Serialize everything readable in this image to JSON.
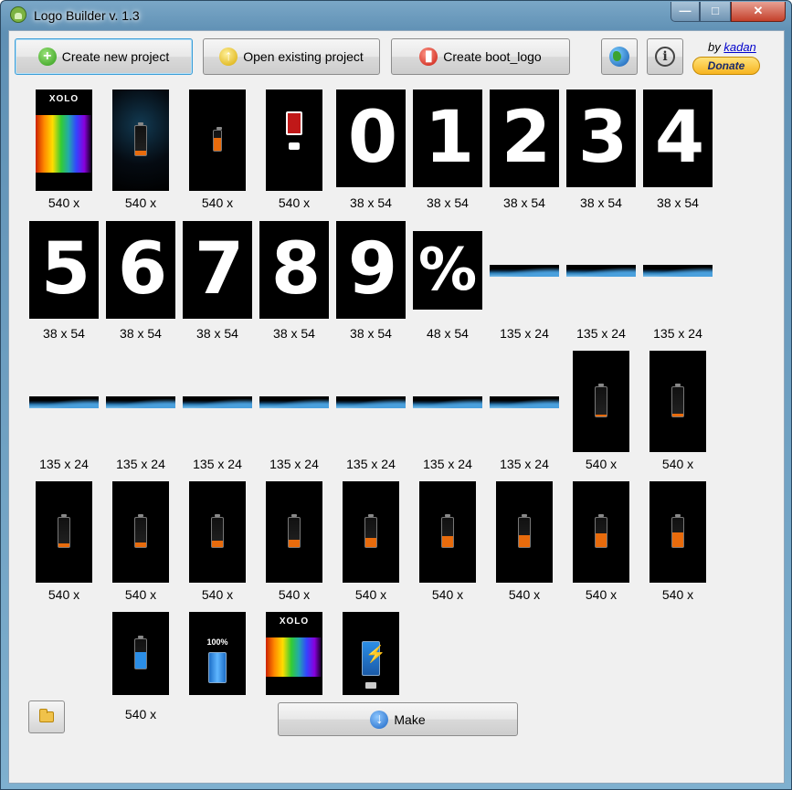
{
  "window": {
    "title": "Logo Builder v. 1.3",
    "min": "—",
    "max": "□",
    "close": "✕"
  },
  "toolbar": {
    "new_project": "Create new project",
    "open_project": "Open existing project",
    "boot_logo": "Create boot_logo",
    "by": "by",
    "author": "kadan",
    "donate": "Donate"
  },
  "splash_text": "XOLO",
  "charge_text": "100%",
  "tiles": [
    {
      "label": "540 x",
      "kind": "splash"
    },
    {
      "label": "540 x",
      "kind": "dark-battery"
    },
    {
      "label": "540 x",
      "kind": "small-battery"
    },
    {
      "label": "540 x",
      "kind": "warning"
    },
    {
      "label": "38 x 54",
      "kind": "digit",
      "glyph": "0"
    },
    {
      "label": "38 x 54",
      "kind": "digit",
      "glyph": "1"
    },
    {
      "label": "38 x 54",
      "kind": "digit",
      "glyph": "2"
    },
    {
      "label": "38 x 54",
      "kind": "digit",
      "glyph": "3"
    },
    {
      "label": "38 x 54",
      "kind": "digit",
      "glyph": "4"
    },
    {
      "label": "38 x 54",
      "kind": "digit",
      "glyph": "5"
    },
    {
      "label": "38 x 54",
      "kind": "digit",
      "glyph": "6"
    },
    {
      "label": "38 x 54",
      "kind": "digit",
      "glyph": "7"
    },
    {
      "label": "38 x 54",
      "kind": "digit",
      "glyph": "8"
    },
    {
      "label": "38 x 54",
      "kind": "digit",
      "glyph": "9"
    },
    {
      "label": "48 x 54",
      "kind": "percent",
      "glyph": "%"
    },
    {
      "label": "135 x 24",
      "kind": "bar"
    },
    {
      "label": "135 x 24",
      "kind": "bar"
    },
    {
      "label": "135 x 24",
      "kind": "bar"
    },
    {
      "label": "135 x 24",
      "kind": "bar"
    },
    {
      "label": "135 x 24",
      "kind": "bar"
    },
    {
      "label": "135 x 24",
      "kind": "bar"
    },
    {
      "label": "135 x 24",
      "kind": "bar"
    },
    {
      "label": "135 x 24",
      "kind": "bar"
    },
    {
      "label": "135 x 24",
      "kind": "bar"
    },
    {
      "label": "135 x 24",
      "kind": "bar"
    },
    {
      "label": "540 x",
      "kind": "battery",
      "level": 0.05
    },
    {
      "label": "540 x",
      "kind": "battery",
      "level": 0.08
    },
    {
      "label": "540 x",
      "kind": "battery",
      "level": 0.1
    },
    {
      "label": "540 x",
      "kind": "battery",
      "level": 0.15
    },
    {
      "label": "540 x",
      "kind": "battery",
      "level": 0.2
    },
    {
      "label": "540 x",
      "kind": "battery",
      "level": 0.25
    },
    {
      "label": "540 x",
      "kind": "battery",
      "level": 0.3
    },
    {
      "label": "540 x",
      "kind": "battery",
      "level": 0.35
    },
    {
      "label": "540 x",
      "kind": "battery",
      "level": 0.4
    },
    {
      "label": "540 x",
      "kind": "battery",
      "level": 0.45
    },
    {
      "label": "540 x",
      "kind": "battery",
      "level": 0.5
    },
    {
      "label": "540 x",
      "kind": "battery-blue",
      "level": 0.55
    },
    {
      "label": "",
      "kind": "charged"
    },
    {
      "label": "",
      "kind": "splash"
    },
    {
      "label": "",
      "kind": "charging"
    }
  ],
  "bottom": {
    "make": "Make"
  },
  "colors": {
    "accent": "#3c9ed8",
    "battery_orange": "#e86b0c",
    "battery_blue": "#2b8ee6"
  }
}
